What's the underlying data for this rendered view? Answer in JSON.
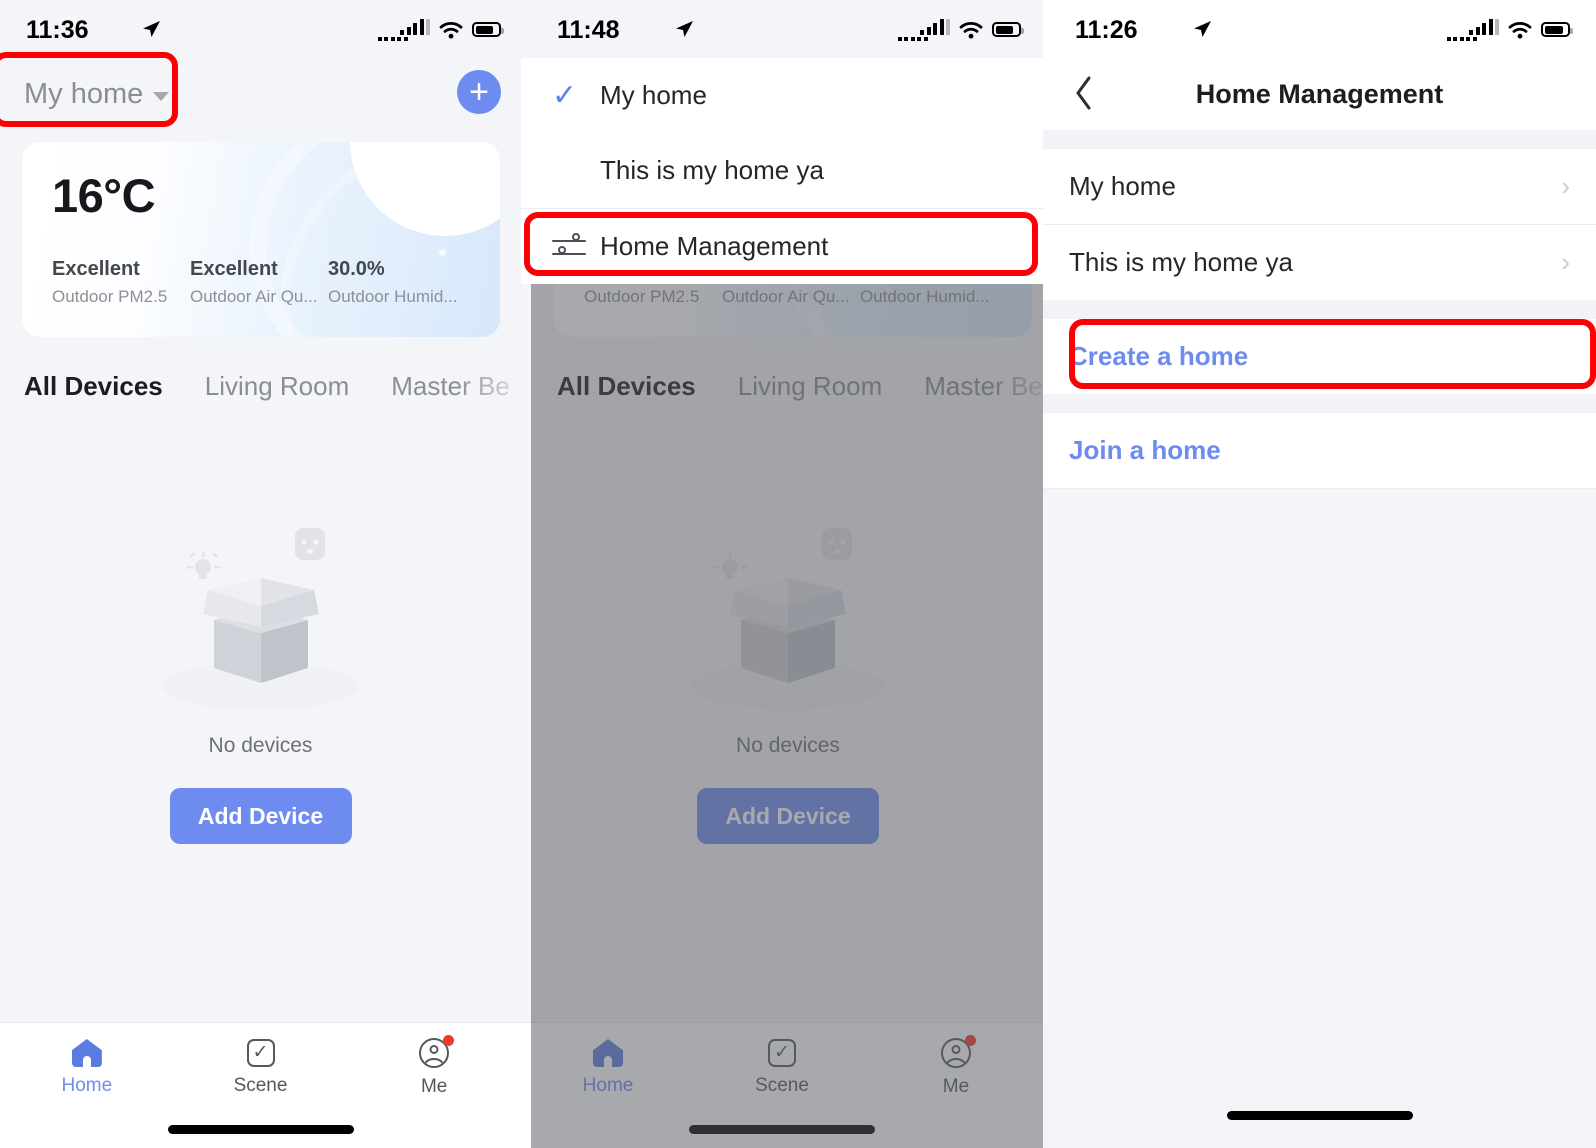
{
  "accent": "#6e8cf0",
  "link_color": "#6e8cf0",
  "annotation_color": "#fb0005",
  "panels": [
    {
      "name": "home-screen",
      "status_bar": {
        "time": "11:36",
        "location_icon": "location-arrow-icon",
        "signal_icon": "cellular-signal-icon",
        "wifi_icon": "wifi-icon",
        "battery_icon": "battery-icon"
      },
      "header": {
        "home_name": "My home",
        "caret_icon": "chevron-down-icon",
        "add_label": "+"
      },
      "weather_card": {
        "temperature": "16°C",
        "stats": [
          {
            "value": "Excellent",
            "label": "Outdoor PM2.5"
          },
          {
            "value": "Excellent",
            "label": "Outdoor Air Qu..."
          },
          {
            "value": "30.0%",
            "label": "Outdoor Humid..."
          }
        ]
      },
      "room_tabs": {
        "items": [
          "All Devices",
          "Living Room",
          "Master Be"
        ],
        "active": "All Devices",
        "more_label": "•••"
      },
      "empty_state": {
        "illustration": "empty-box-illustration",
        "text": "No devices",
        "button_label": "Add Device"
      },
      "tabbar": {
        "items": [
          {
            "label": "Home",
            "icon": "home-icon",
            "active": true,
            "badge": false
          },
          {
            "label": "Scene",
            "icon": "scene-checkbox-icon",
            "active": false,
            "badge": false
          },
          {
            "label": "Me",
            "icon": "profile-icon",
            "active": false,
            "badge": true
          }
        ]
      }
    },
    {
      "name": "home-dropdown-screen",
      "status_bar": {
        "time": "11:48",
        "location_icon": "location-arrow-icon",
        "signal_icon": "cellular-signal-icon",
        "wifi_icon": "wifi-icon",
        "battery_icon": "battery-icon"
      },
      "dropdown": {
        "items": [
          {
            "label": "My home",
            "selected": true,
            "check_icon": "check-icon"
          },
          {
            "label": "This is my home ya",
            "selected": false,
            "check_icon": ""
          },
          {
            "label": "Home Management",
            "selected": false,
            "icon": "sliders-icon"
          }
        ]
      },
      "weather_card": {
        "stats": [
          {
            "label": "Outdoor PM2.5"
          },
          {
            "label": "Outdoor Air Qu..."
          },
          {
            "label": "Outdoor Humid..."
          }
        ]
      },
      "room_tabs": {
        "items": [
          "All Devices",
          "Living Room",
          "Master Be"
        ],
        "active": "All Devices",
        "more_label": "•••"
      },
      "empty_state": {
        "text": "No devices",
        "button_label": "Add Device"
      },
      "tabbar": {
        "items": [
          {
            "label": "Home",
            "icon": "home-icon",
            "active": true,
            "badge": false
          },
          {
            "label": "Scene",
            "icon": "scene-checkbox-icon",
            "active": false,
            "badge": false
          },
          {
            "label": "Me",
            "icon": "profile-icon",
            "active": false,
            "badge": true
          }
        ]
      }
    },
    {
      "name": "home-management-screen",
      "status_bar": {
        "time": "11:26",
        "location_icon": "location-arrow-icon",
        "signal_icon": "cellular-signal-icon",
        "wifi_icon": "wifi-icon",
        "battery_icon": "battery-icon"
      },
      "nav": {
        "back_icon": "chevron-left-icon",
        "title": "Home Management"
      },
      "homes": [
        {
          "label": "My home",
          "chevron": "›"
        },
        {
          "label": "This is my home ya",
          "chevron": "›"
        }
      ],
      "actions": [
        {
          "label": "Create a home"
        },
        {
          "label": "Join a home"
        }
      ]
    }
  ],
  "annotations": [
    {
      "name": "highlight-my-home-selector",
      "target": "My home"
    },
    {
      "name": "highlight-home-management",
      "target": "Home Management"
    },
    {
      "name": "highlight-create-a-home",
      "target": "Create a home"
    }
  ]
}
